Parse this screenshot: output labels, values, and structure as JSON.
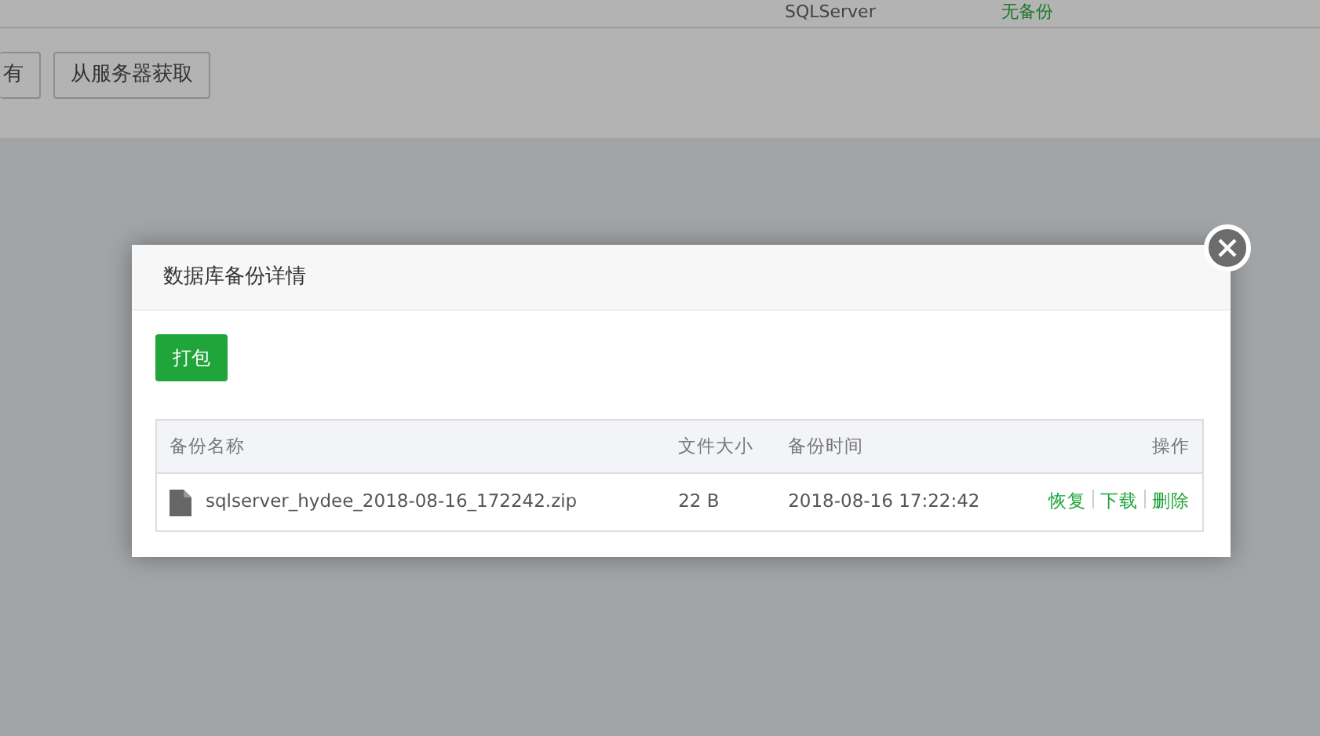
{
  "background": {
    "top_row": [
      "SQLServer",
      "无备份"
    ],
    "buttons": [
      "有",
      "从服务器获取"
    ]
  },
  "dialog": {
    "title": "数据库备份详情",
    "pack_button": "打包",
    "table": {
      "columns": [
        "备份名称",
        "文件大小",
        "备份时间",
        "操作"
      ],
      "rows": [
        {
          "name": "sqlserver_hydee_2018-08-16_172242.zip",
          "size": "22 B",
          "time": "2018-08-16 17:22:42",
          "actions": [
            "恢复",
            "下载",
            "删除"
          ]
        }
      ]
    }
  }
}
